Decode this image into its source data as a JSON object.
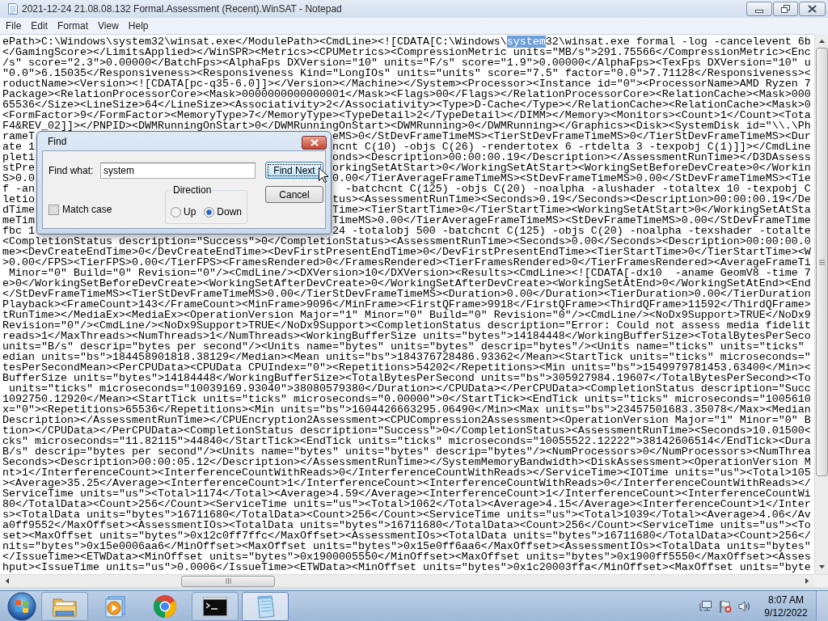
{
  "window": {
    "title": "2021-12-24 21.08.08.132 Formal.Assessment (Recent).WinSAT - Notepad"
  },
  "menu": [
    "File",
    "Edit",
    "Format",
    "View",
    "Help"
  ],
  "editor": {
    "lines": [
      {
        "kind": "match",
        "segments": [
          {
            "text": "ePath>C:\\Windows\\system32\\winsat.exe</ModulePath><CmdLine><![CDATA[C:\\Windows\\",
            "selected": false
          },
          {
            "text": "system",
            "selected": true
          },
          {
            "text": "32\\winsat.exe formal -log -cancelevent 6b",
            "selected": false
          }
        ]
      },
      {
        "kind": "text",
        "text": "</GamingScore></LimitsApplied></WinSPR><Metrics><CPUMetrics><CompressionMetric units=\"MB/s\">291.75566</CompressionMetric><Enc"
      },
      {
        "kind": "text",
        "text": "/s\" score=\"2.3\">0.00000</BatchFps><AlphaFps DXVersion=\"10\" units=\"F/s\" score=\"1.9\">0.00000</AlphaFps><TexFps DXVersion=\"10\" u"
      },
      {
        "kind": "text",
        "text": "\"0.0\">6.15035</Responsiveness><Responsiveness Kind=\"LongIOs\" units=\"units\" score=\"7.5\" factor=\"0.0\">7.71128</Responsiveness><"
      },
      {
        "kind": "text",
        "text": "roductName><Version><![CDATA[pc-q35-6.0]]></Version></Machine></System><Processor><Instance id=\"0\"><ProcessorName>AMD Ryzen 7"
      },
      {
        "kind": "text",
        "text": "Package><RelationProcessorCore><Mask>0000000000000001</Mask><Flags>00</Flags></RelationProcessorCore><RelationCache><Mask>000"
      },
      {
        "kind": "text",
        "text": "65536</Size><LineSize>64</LineSize><Associativity>2</Associativity><Type>D-Cache</Type></RelationCache><RelationCache><Mask>0"
      },
      {
        "kind": "text",
        "text": "<FormFactor>9</FormFactor><MemoryType>7</MemoryType><TypeDetail>2</TypeDetail></DIMM></Memory><Monitors><Count>1</Count><Tota"
      },
      {
        "kind": "text",
        "text": "F4&REV_02]]></PNPID><DWMRunningOnStart>0</DWMRunningOnStart><DWMRunning>0</DWMRunning></Graphics><Disk><SystemDisk id=\"\\\\.\\Ph"
      },
      {
        "kind": "covered",
        "left": "rameT",
        "right": "eMS>0</StDevFrameTimeMS><TierStDevFrameTimeMS>0</TierStDevFrameTimeMS><Dur"
      },
      {
        "kind": "covered",
        "left": "ate 1",
        "right": "ncnt C(10) -objs C(26) -rendertotex 6 -rtdelta 3 -texpobj C(1)]]></CmdLine"
      },
      {
        "kind": "covered",
        "left": "pleti",
        "right": "onds><Description>00:00:00.19</Description></AssessmentRunTime></D3DAssess"
      },
      {
        "kind": "covered",
        "left": "stPre",
        "right": "orkingSetAtStart>0</WorkingSetAtStart><WorkingSetBeforeDevCreate>0</Workin"
      },
      {
        "kind": "covered",
        "left": "S>0.0",
        "right": "0.00</TierAverageFrameTimeMS><StDevFrameTimeMS>0.00</StDevFrameTimeMS><Tie"
      },
      {
        "kind": "covered",
        "left": "f -an",
        "right": "-batchcnt C(125) -objs C(20) -noalpha -alushader -totaltex 10 -texpobj C"
      },
      {
        "kind": "covered",
        "left": "letio",
        "right": "tus><AssessmentRunTime><Seconds>0.19</Seconds><Description>00:00:00.19</De"
      },
      {
        "kind": "covered",
        "left": "dTime",
        "right": "Time><TierStartTime>0</TierStartTime><WorkingSetAtStart>0</WorkingSetAtSta"
      },
      {
        "kind": "covered",
        "left": "meTim",
        "right": "TimeMS>0.00</TierAverageFrameTimeMS><StDevFrameTimeMS>0.00</StDevFrameTime"
      },
      {
        "kind": "covered",
        "left": "fbc 1",
        "right": "24 -totalobj 500 -batchcnt C(125) -objs C(20) -noalpha -texshader -totalte"
      },
      {
        "kind": "text",
        "text": "<CompletionStatus description=\"Success\">0</CompletionStatus><AssessmentRunTime><Seconds>0.00</Seconds><Description>00:00:00.0"
      },
      {
        "kind": "text",
        "text": "me><DevCreateEndTime>0</DevCreateEndTime><DevFirstPresentEndTime>0</DevFirstPresentEndTime><TierStartTime>0</TierStartTime><W"
      },
      {
        "kind": "text",
        "text": ">0.00</FPS><TierFPS>0.00</TierFPS><FramesRendered>0</FramesRendered><TierFramesRendered>0</TierFramesRendered><AverageFrameTi"
      },
      {
        "kind": "text",
        "text": " Minor=\"0\" Build=\"0\" Revision=\"0\"/><CmdLine/><DXVersion>10</DXVersion><Results><CmdLine><![CDATA[-dx10  -aname GeomV8 -time 7"
      },
      {
        "kind": "text",
        "text": "e>0</WorkingSetBeforeDevCreate><WorkingSetAfterDevCreate>0</WorkingSetAfterDevCreate><WorkingSetAtEnd>0</WorkingSetAtEnd><End"
      },
      {
        "kind": "text",
        "text": "</StDevFrameTimeMS><TierStDevFrameTimeMS>0.00</TierStDevFrameTimeMS><Duration>0.00</Duration><TierDuration>0.00</TierDuration"
      },
      {
        "kind": "text",
        "text": "Playback><FrameCount>143</FrameCount><MinFrame>9096</MinFrame><FirstQFrame>9918</FirstQFrame><ThirdQFrame>11592</ThirdQFrame>"
      },
      {
        "kind": "text",
        "text": "tRunTime></MediaEx><MediaEx><OperationVersion Major=\"1\" Minor=\"0\" Build=\"0\" Revision=\"0\"/><CmdLine/><NoDx9Support>TRUE</NoDx9"
      },
      {
        "kind": "text",
        "text": "Revision=\"0\"/><CmdLine/><NoDx9Support>TRUE</NoDx9Support><CompletionStatus description=\"Error: Could not assess media fidelit"
      },
      {
        "kind": "text",
        "text": "reads>1</MaxThreads><NumThreads>1</NumThreads><WorkingBufferSize units=\"bytes\">14184448</WorkingBufferSize><TotalBytesPerSeco"
      },
      {
        "kind": "text",
        "text": "units=\"B/s\" descrip=\"bytes per second\"/><Units name=\"bytes\" units=\"bytes\" descrip=\"bytes\"/><Units name=\"ticks\" units=\"ticks\""
      },
      {
        "kind": "text",
        "text": "edian units=\"bs\">184458901818.38129</Median><Mean units=\"bs\">184376728486.93362</Mean><StartTick units=\"ticks\" microseconds=\""
      },
      {
        "kind": "text",
        "text": "tesPerSecondMean><PerCPUData><CPUData CPUIndex=\"0\"><Repetitions>54202</Repetitions><Min units=\"bs\">1549979781453.63400</Min><"
      },
      {
        "kind": "text",
        "text": "BufferSize units=\"bytes\">14184448</WorkingBufferSize><TotalBytesPerSecond units=\"bs\">305927984.19607</TotalBytesPerSecond><To"
      },
      {
        "kind": "text",
        "text": " units=\"ticks\" microseconds=\"10039169.93040\">38080579380</Duration></CPUData></PerCPUData><CompletionStatus description=\"Succ"
      },
      {
        "kind": "text",
        "text": "1092750.12920</Mean><StartTick units=\"ticks\" microseconds=\"0.00000\">0</StartTick><EndTick units=\"ticks\" microseconds=\"1005610"
      },
      {
        "kind": "text",
        "text": "x=\"0\"><Repetitions>65536</Repetitions><Min units=\"bs\">1604426663295.06490</Min><Max units=\"bs\">23457501683.35078</Max><Median"
      },
      {
        "kind": "text",
        "text": "Description></AssessmentRunTime></CPUEncryption2Assessment><CPUCompression2Assessment><OperationVersion Major=\"1\" Minor=\"0\" B"
      },
      {
        "kind": "text",
        "text": "tion></CPUData></PerCPUData><CompletionStatus description=\"Success\">0</CompletionStatus><AssessmentRunTime><Seconds>10.01500<"
      },
      {
        "kind": "text",
        "text": "cks\" microseconds=\"11.82115\">44840</StartTick><EndTick units=\"ticks\" microseconds=\"10055522.12222\">38142606514</EndTick><Dura"
      },
      {
        "kind": "text",
        "text": "B/s\" descrip=\"bytes per second\"/><Units name=\"bytes\" units=\"bytes\" descrip=\"bytes\"/><NumProcessors>0</NumProcessors><NumThrea"
      },
      {
        "kind": "text",
        "text": "Seconds><Description>00:00:05.12</Description></AssessmentRunTime></SystemMemoryBandwidth><DiskAssessment><OperationVersion M"
      },
      {
        "kind": "text",
        "text": "nt>1</InterferenceCount><InterferenceCountWithReads>0</InterferenceCountWithReads></ServiceTime><IOTime units=\"us\"><Total>105"
      },
      {
        "kind": "text",
        "text": "><Average>35.25</Average><InterferenceCount>1</InterferenceCount><InterferenceCountWithReads>0</InterferenceCountWithReads></"
      },
      {
        "kind": "text",
        "text": "ServiceTime units=\"us\"><Total>1174</Total><Average>4.59</Average><InterferenceCount>1</InterferenceCount><InterferenceCountWi"
      },
      {
        "kind": "text",
        "text": "80</TotalData><Count>256</Count><ServiceTime units=\"us\"><Total>1062</Total><Average>4.15</Average><InterferenceCount>1</Inter"
      },
      {
        "kind": "text",
        "text": "s><TotalData units=\"bytes\">16711680</TotalData><Count>256</Count><ServiceTime units=\"us\"><Total>1039</Total><Average>4.06</Av"
      },
      {
        "kind": "text",
        "text": "a0ff9552</MaxOffset><AssessmentIOs><TotalData units=\"bytes\">16711680</TotalData><Count>256</Count><ServiceTime units=\"us\"><To"
      },
      {
        "kind": "text",
        "text": "set><MaxOffset units=\"bytes\">0x12c0ff7ffc</MaxOffset><AssessmentIOs><TotalData units=\"bytes\">16711680</TotalData><Count>256</"
      },
      {
        "kind": "text",
        "text": "nits=\"bytes\">0x15e0006aa6</MinOffset><MaxOffset units=\"bytes\">0x15e0ff6aa6</MaxOffset><AssessmentIOs><TotalData units=\"bytes\""
      },
      {
        "kind": "text",
        "text": "</IssueTime><ETWData><MinOffset units=\"bytes\">0x1900005550</MinOffset><MaxOffset units=\"bytes\">0x1900ff5550</MaxOffset><Asses"
      },
      {
        "kind": "text",
        "text": "hput><IssueTime units=\"us\">0.0006</IssueTime><ETWData><MinOffset units=\"bytes\">0x1c20003ffa</MinOffset><MaxOffset units=\"byte"
      }
    ]
  },
  "find_dialog": {
    "title": "Find",
    "find_what_label": "Find what:",
    "find_what_value": "system",
    "buttons": [
      {
        "label": "Find Next",
        "focused": true
      },
      {
        "label": "Cancel",
        "focused": false
      }
    ],
    "direction_label": "Direction",
    "directions": [
      {
        "label": "Up",
        "selected": false
      },
      {
        "label": "Down",
        "selected": true
      }
    ],
    "match_case": {
      "label": "Match case",
      "checked": false
    }
  },
  "taskbar": {
    "apps": [
      {
        "kind": "folder",
        "running": true,
        "selected": false
      },
      {
        "kind": "media",
        "running": false,
        "selected": false
      },
      {
        "kind": "browser",
        "running": false,
        "selected": false
      },
      {
        "kind": "terminal",
        "running": true,
        "selected": false
      },
      {
        "kind": "notepad",
        "running": true,
        "selected": true
      }
    ],
    "clock": {
      "time": "8:07 AM",
      "date": "9/12/2022"
    }
  }
}
